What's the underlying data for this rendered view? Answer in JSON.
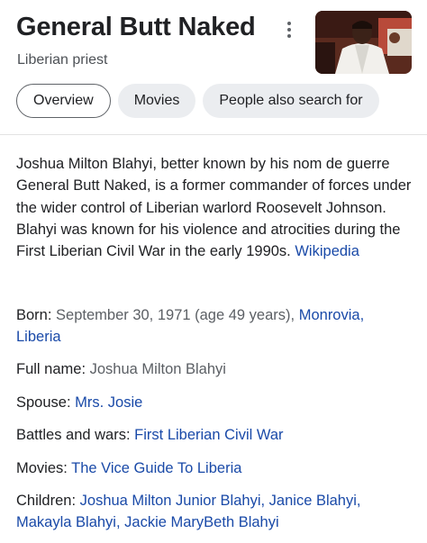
{
  "header": {
    "title": "General Butt Naked",
    "subtitle": "Liberian priest"
  },
  "tabs": [
    {
      "label": "Overview",
      "active": true
    },
    {
      "label": "Movies",
      "active": false
    },
    {
      "label": "People also search for",
      "active": false
    }
  ],
  "description": {
    "text": "Joshua Milton Blahyi, better known by his nom de guerre General Butt Naked, is a former commander of forces under the wider control of Liberian warlord Roosevelt Johnson. Blahyi was known for his violence and atrocities during the First Liberian Civil War in the early 1990s.",
    "source_link": "Wikipedia"
  },
  "facts": {
    "born": {
      "label": "Born:",
      "value": "September 30, 1971 (age 49 years),",
      "link": "Monrovia, Liberia"
    },
    "full_name": {
      "label": "Full name:",
      "value": "Joshua Milton Blahyi"
    },
    "spouse": {
      "label": "Spouse:",
      "link": "Mrs. Josie"
    },
    "battles": {
      "label": "Battles and wars:",
      "link": "First Liberian Civil War"
    },
    "movies": {
      "label": "Movies:",
      "link": "The Vice Guide To Liberia"
    },
    "children": {
      "label": "Children:",
      "links": [
        "Joshua Milton Junior Blahyi,",
        "Janice Blahyi,",
        "Makayla Blahyi,",
        "Jackie MaryBeth Blahyi"
      ]
    }
  },
  "icons": {
    "menu": "more-vert-icon",
    "thumbnail": "person-photo"
  },
  "colors": {
    "link": "#1a4aa8",
    "chip_bg": "#ebedf0",
    "text": "#202124",
    "muted": "#5b5f64"
  }
}
